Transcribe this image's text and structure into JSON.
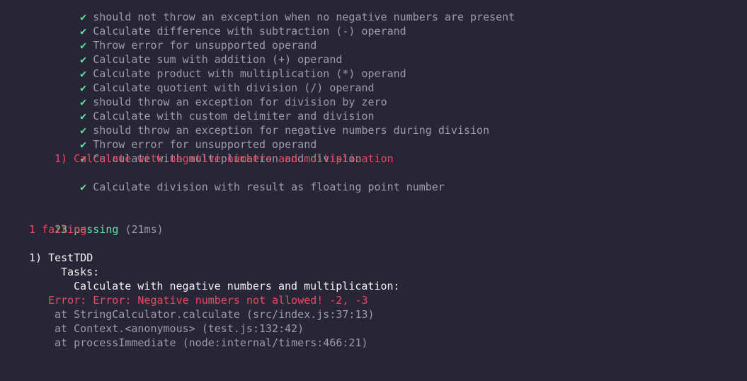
{
  "passed_tests": [
    "should not throw an exception when no negative numbers are present",
    "Calculate difference with subtraction (-) operand",
    "Throw error for unsupported operand",
    "Calculate sum with addition (+) operand",
    "Calculate product with multiplication (*) operand",
    "Calculate quotient with division (/) operand",
    "should throw an exception for division by zero",
    "Calculate with custom delimiter and division",
    "should throw an exception for negative numbers during division",
    "Throw error for unsupported operand",
    "Calculate with multiplication and division"
  ],
  "failed_test": "1) Calculate with negative numbers and multiplication",
  "last_passed_test": "Calculate division with result as floating point number",
  "checkmark": "✔",
  "summary": {
    "passing": "23 passing",
    "duration": "(21ms)",
    "failing": "1 failing"
  },
  "failure": {
    "header": "1) TestTDD",
    "suite": "Tasks:",
    "test": "Calculate with negative numbers and multiplication:",
    "error": "Error: Error: Negative numbers not allowed! -2, -3",
    "stack": [
      "at StringCalculator.calculate (src/index.js:37:13)",
      "at Context.<anonymous> (test.js:132:42)",
      "at processImmediate (node:internal/timers:466:21)"
    ]
  }
}
